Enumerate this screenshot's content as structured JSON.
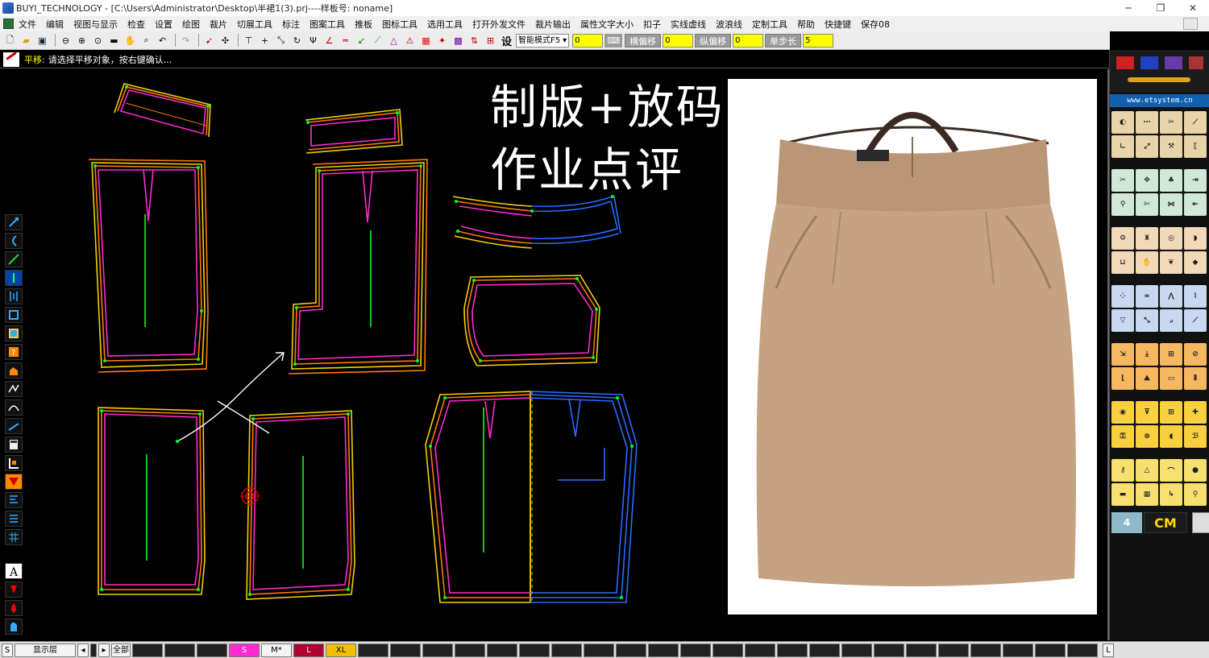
{
  "window": {
    "title": "BUYI_TECHNOLOGY - [C:\\Users\\Administrator\\Desktop\\半裙1(3).prj----样板号: noname]",
    "controls": [
      "─",
      "❐",
      "✕"
    ]
  },
  "menu": [
    "文件",
    "编辑",
    "视图与显示",
    "检查",
    "设置",
    "绘图",
    "裁片",
    "切展工具",
    "标注",
    "图案工具",
    "推板",
    "图标工具",
    "选用工具",
    "打开外发文件",
    "裁片输出",
    "属性文字大小",
    "扣子",
    "实线虚线",
    "波浪线",
    "定制工具",
    "帮助",
    "快捷键",
    "保存08"
  ],
  "toolbar": {
    "mode_select": "智能模式F5",
    "field_1": "0",
    "h_offset_label": "横偏移",
    "h_offset_value": "0",
    "v_offset_label": "纵偏移",
    "v_offset_value": "0",
    "step_label": "单步长",
    "step_value": "5",
    "set_label": "设"
  },
  "status": {
    "command": "平移:",
    "message": "请选择平移对象，按右键确认..."
  },
  "overlay": {
    "line1": "制版+放码",
    "line2": "作业点评"
  },
  "right_panel": {
    "website": "www.etsystem.cn",
    "unit": "CM",
    "counter": "4"
  },
  "bottom": {
    "s_label": "S",
    "layer_label": "显示层",
    "all_label": "全部",
    "sizes": [
      {
        "label": "S",
        "color": "#ff2bd0"
      },
      {
        "label": "M*",
        "color": "#f4f4f4"
      },
      {
        "label": "L",
        "color": "#b00030"
      },
      {
        "label": "XL",
        "color": "#f0c000"
      }
    ],
    "right_label": "L"
  },
  "colors": {
    "size_s": "#ff2bd0",
    "size_m": "#ffffff",
    "size_l": "#ff7a00",
    "size_xl": "#f3d000",
    "points": "#00ff22",
    "blue_grade": "#2a6cff",
    "skirt": "#c4a282"
  }
}
